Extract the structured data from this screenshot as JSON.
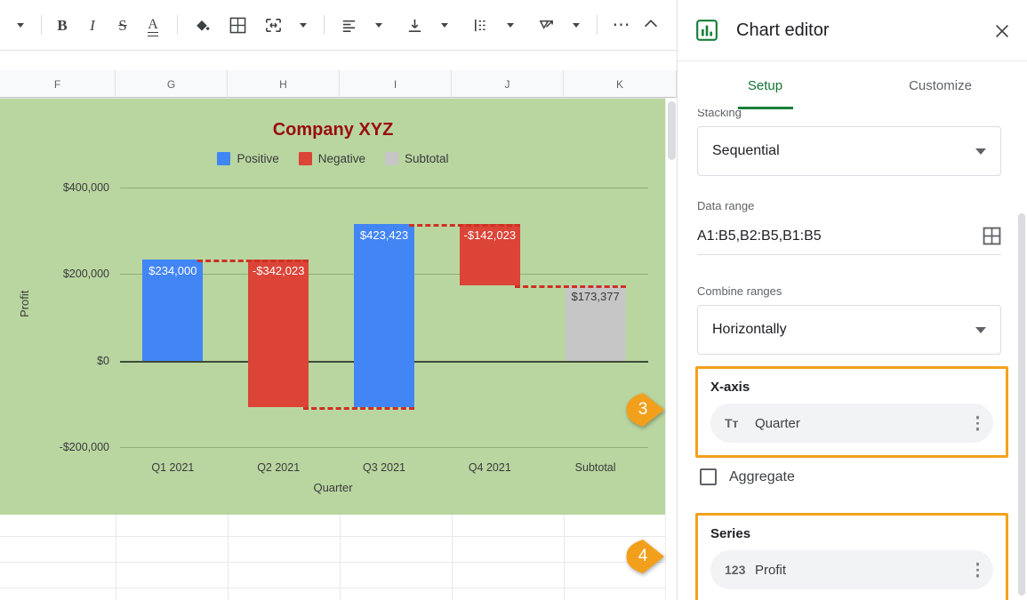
{
  "toolbar": {
    "items": [
      {
        "name": "font-size-dropdown-caret",
        "glyph": "caret"
      },
      {
        "name": "bold-button",
        "glyph": "B"
      },
      {
        "name": "italic-button",
        "glyph": "I"
      },
      {
        "name": "strikethrough-button",
        "glyph": "S"
      },
      {
        "name": "text-color-button",
        "glyph": "A"
      },
      {
        "name": "fill-color-button",
        "glyph": "paint"
      },
      {
        "name": "borders-button",
        "glyph": "grid"
      },
      {
        "name": "merge-cells-button",
        "glyph": "merge"
      },
      {
        "name": "horizontal-align-button",
        "glyph": "align"
      },
      {
        "name": "vertical-align-button",
        "glyph": "valign"
      },
      {
        "name": "text-wrapping-button",
        "glyph": "wrap"
      },
      {
        "name": "text-rotation-button",
        "glyph": "rotate"
      },
      {
        "name": "more-options-button",
        "glyph": "..."
      }
    ],
    "collapse_label": "collapse-toolbar"
  },
  "spreadsheet": {
    "column_headers": [
      "F",
      "G",
      "H",
      "I",
      "J",
      "K"
    ]
  },
  "chart_data": {
    "type": "bar",
    "title": "Company XYZ",
    "xlabel": "Quarter",
    "ylabel": "Profit",
    "categories": [
      "Q1 2021",
      "Q2 2021",
      "Q3 2021",
      "Q4 2021",
      "Subtotal"
    ],
    "values": [
      234000,
      -342023,
      423423,
      -142023,
      173377
    ],
    "value_labels": [
      "$234,000",
      "-$342,023",
      "$423,423",
      "-$142,023",
      "$173,377"
    ],
    "bar_kinds": [
      "positive",
      "negative",
      "positive",
      "negative",
      "subtotal"
    ],
    "bar_bases": [
      0,
      234000,
      -108023,
      315400,
      0
    ],
    "bar_tops": [
      234000,
      -108023,
      315400,
      173377,
      173377
    ],
    "ylim": [
      -200000,
      400000
    ],
    "yticks": [
      400000,
      200000,
      0,
      -200000
    ],
    "ytick_labels": [
      "$400,000",
      "$200,000",
      "$0",
      "-$200,000"
    ],
    "grid": true,
    "legend_position": "top",
    "legend": [
      {
        "label": "Positive",
        "color": "#4285f4"
      },
      {
        "label": "Negative",
        "color": "#db4437"
      },
      {
        "label": "Subtotal",
        "color": "#c6c6c6"
      }
    ],
    "connector_color": "#cc3124",
    "plot_background": "#b9d6a1",
    "title_color": "#9a0c0c"
  },
  "panel": {
    "icon_name": "chart-editor-icon",
    "title": "Chart editor",
    "close_label": "close-icon",
    "tabs": [
      {
        "label": "Setup",
        "active": true
      },
      {
        "label": "Customize",
        "active": false
      }
    ],
    "stacking": {
      "label": "Stacking",
      "value": "Sequential"
    },
    "data_range": {
      "label": "Data range",
      "value": "A1:B5,B2:B5,B1:B5",
      "picker_icon": "select-data-range-icon"
    },
    "combine_ranges": {
      "label": "Combine ranges",
      "value": "Horizontally"
    },
    "x_axis": {
      "label": "X-axis",
      "chip_icon": "text-type-icon",
      "chip_icon_glyph": "Tт",
      "chip_label": "Quarter",
      "more_label": "more-options-icon",
      "highlight_color": "#f3a11b"
    },
    "aggregate": {
      "label": "Aggregate",
      "checked": false
    },
    "series": {
      "label": "Series",
      "chip_icon": "number-type-icon",
      "chip_icon_glyph": "123",
      "chip_label": "Profit",
      "more_label": "more-options-icon",
      "highlight_color": "#f3a11b"
    }
  },
  "callouts": [
    {
      "number": "3",
      "target": "x-axis-section"
    },
    {
      "number": "4",
      "target": "series-section"
    }
  ]
}
